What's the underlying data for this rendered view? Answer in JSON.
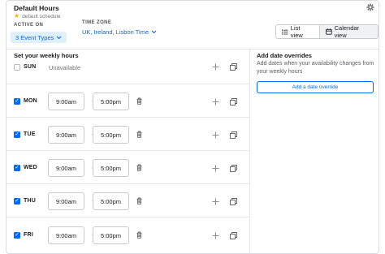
{
  "header": {
    "title": "Default Hours",
    "default_label": "default schedule",
    "active_on_label": "ACTIVE ON",
    "event_types_label": "3 Event Types",
    "time_zone_label": "TIME ZONE",
    "time_zone_value": "UK, Ireland, Lisbon Time",
    "list_view_label": "List view",
    "calendar_view_label": "Calendar view",
    "accent_color": "#0069ff"
  },
  "weekly": {
    "title": "Set your weekly hours",
    "days": [
      {
        "day": "SUN",
        "checked": false,
        "unavailable_text": "Unavailable"
      },
      {
        "day": "MON",
        "checked": true,
        "start": "9:00am",
        "end": "5:00pm"
      },
      {
        "day": "TUE",
        "checked": true,
        "start": "9:00am",
        "end": "5:00pm"
      },
      {
        "day": "WED",
        "checked": true,
        "start": "9:00am",
        "end": "5:00pm"
      },
      {
        "day": "THU",
        "checked": true,
        "start": "9:00am",
        "end": "5:00pm"
      },
      {
        "day": "FRI",
        "checked": true,
        "start": "9:00am",
        "end": "5:00pm"
      }
    ],
    "separator": "-"
  },
  "overrides": {
    "title": "Add date overrides",
    "description": "Add dates when your availability changes from your weekly hours",
    "button_label": "Add a date override"
  }
}
